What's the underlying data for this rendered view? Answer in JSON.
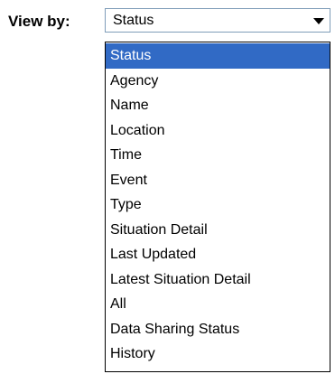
{
  "view_by": {
    "label": "View by:",
    "selected_value": "Status",
    "options": [
      "Status",
      "Agency",
      "Name",
      "Location",
      "Time",
      "Event",
      "Type",
      "Situation Detail",
      "Last Updated",
      "Latest Situation Detail",
      "All",
      "Data Sharing Status",
      "History"
    ],
    "highlighted_index": 0
  },
  "colors": {
    "highlight_background": "#316ac5",
    "highlight_text": "#ffffff",
    "select_border": "#7f9db9"
  }
}
